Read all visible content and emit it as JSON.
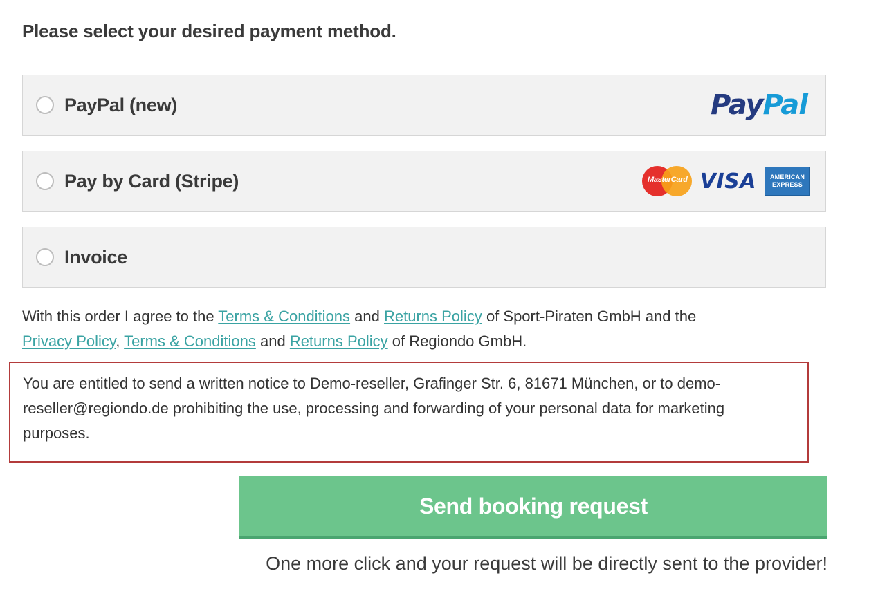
{
  "heading": "Please select your desired payment method.",
  "payment_methods": [
    {
      "label": "PayPal (new)",
      "logos": [
        "paypal-logo"
      ],
      "paypal_text": [
        "Pay",
        "Pal"
      ]
    },
    {
      "label": "Pay by Card (Stripe)",
      "logos": [
        "mastercard-logo",
        "visa-logo",
        "amex-logo"
      ],
      "mastercard_text": "MasterCard",
      "visa_text": "VISA",
      "amex_text": [
        "AMERICAN",
        "EXPRESS"
      ]
    },
    {
      "label": "Invoice",
      "logos": []
    }
  ],
  "terms": {
    "prefix": "With this order I agree to the ",
    "link_terms_1": "Terms & Conditions",
    "and_1": " and ",
    "link_returns_1": "Returns Policy",
    "middle": " of Sport-Piraten GmbH and the",
    "link_privacy": "Privacy Policy",
    "comma": ", ",
    "link_terms_2": "Terms & Conditions",
    "and_2": " and ",
    "link_returns_2": "Returns Policy",
    "suffix": " of Regiondo GmbH."
  },
  "notice": "You are entitled to send a written notice to Demo-reseller, Grafinger Str. 6, 81671 München, or to demo-reseller@regiondo.de prohibiting the use, processing and forwarding of your personal data for marketing purposes.",
  "submit_button": "Send booking request",
  "hint": "One more click and your request will be directly sent to the provider!",
  "colors": {
    "accent_green": "#6cc58c",
    "link_teal": "#3aa3a3",
    "notice_border": "#b33b3b",
    "panel_bg": "#f2f2f2"
  }
}
